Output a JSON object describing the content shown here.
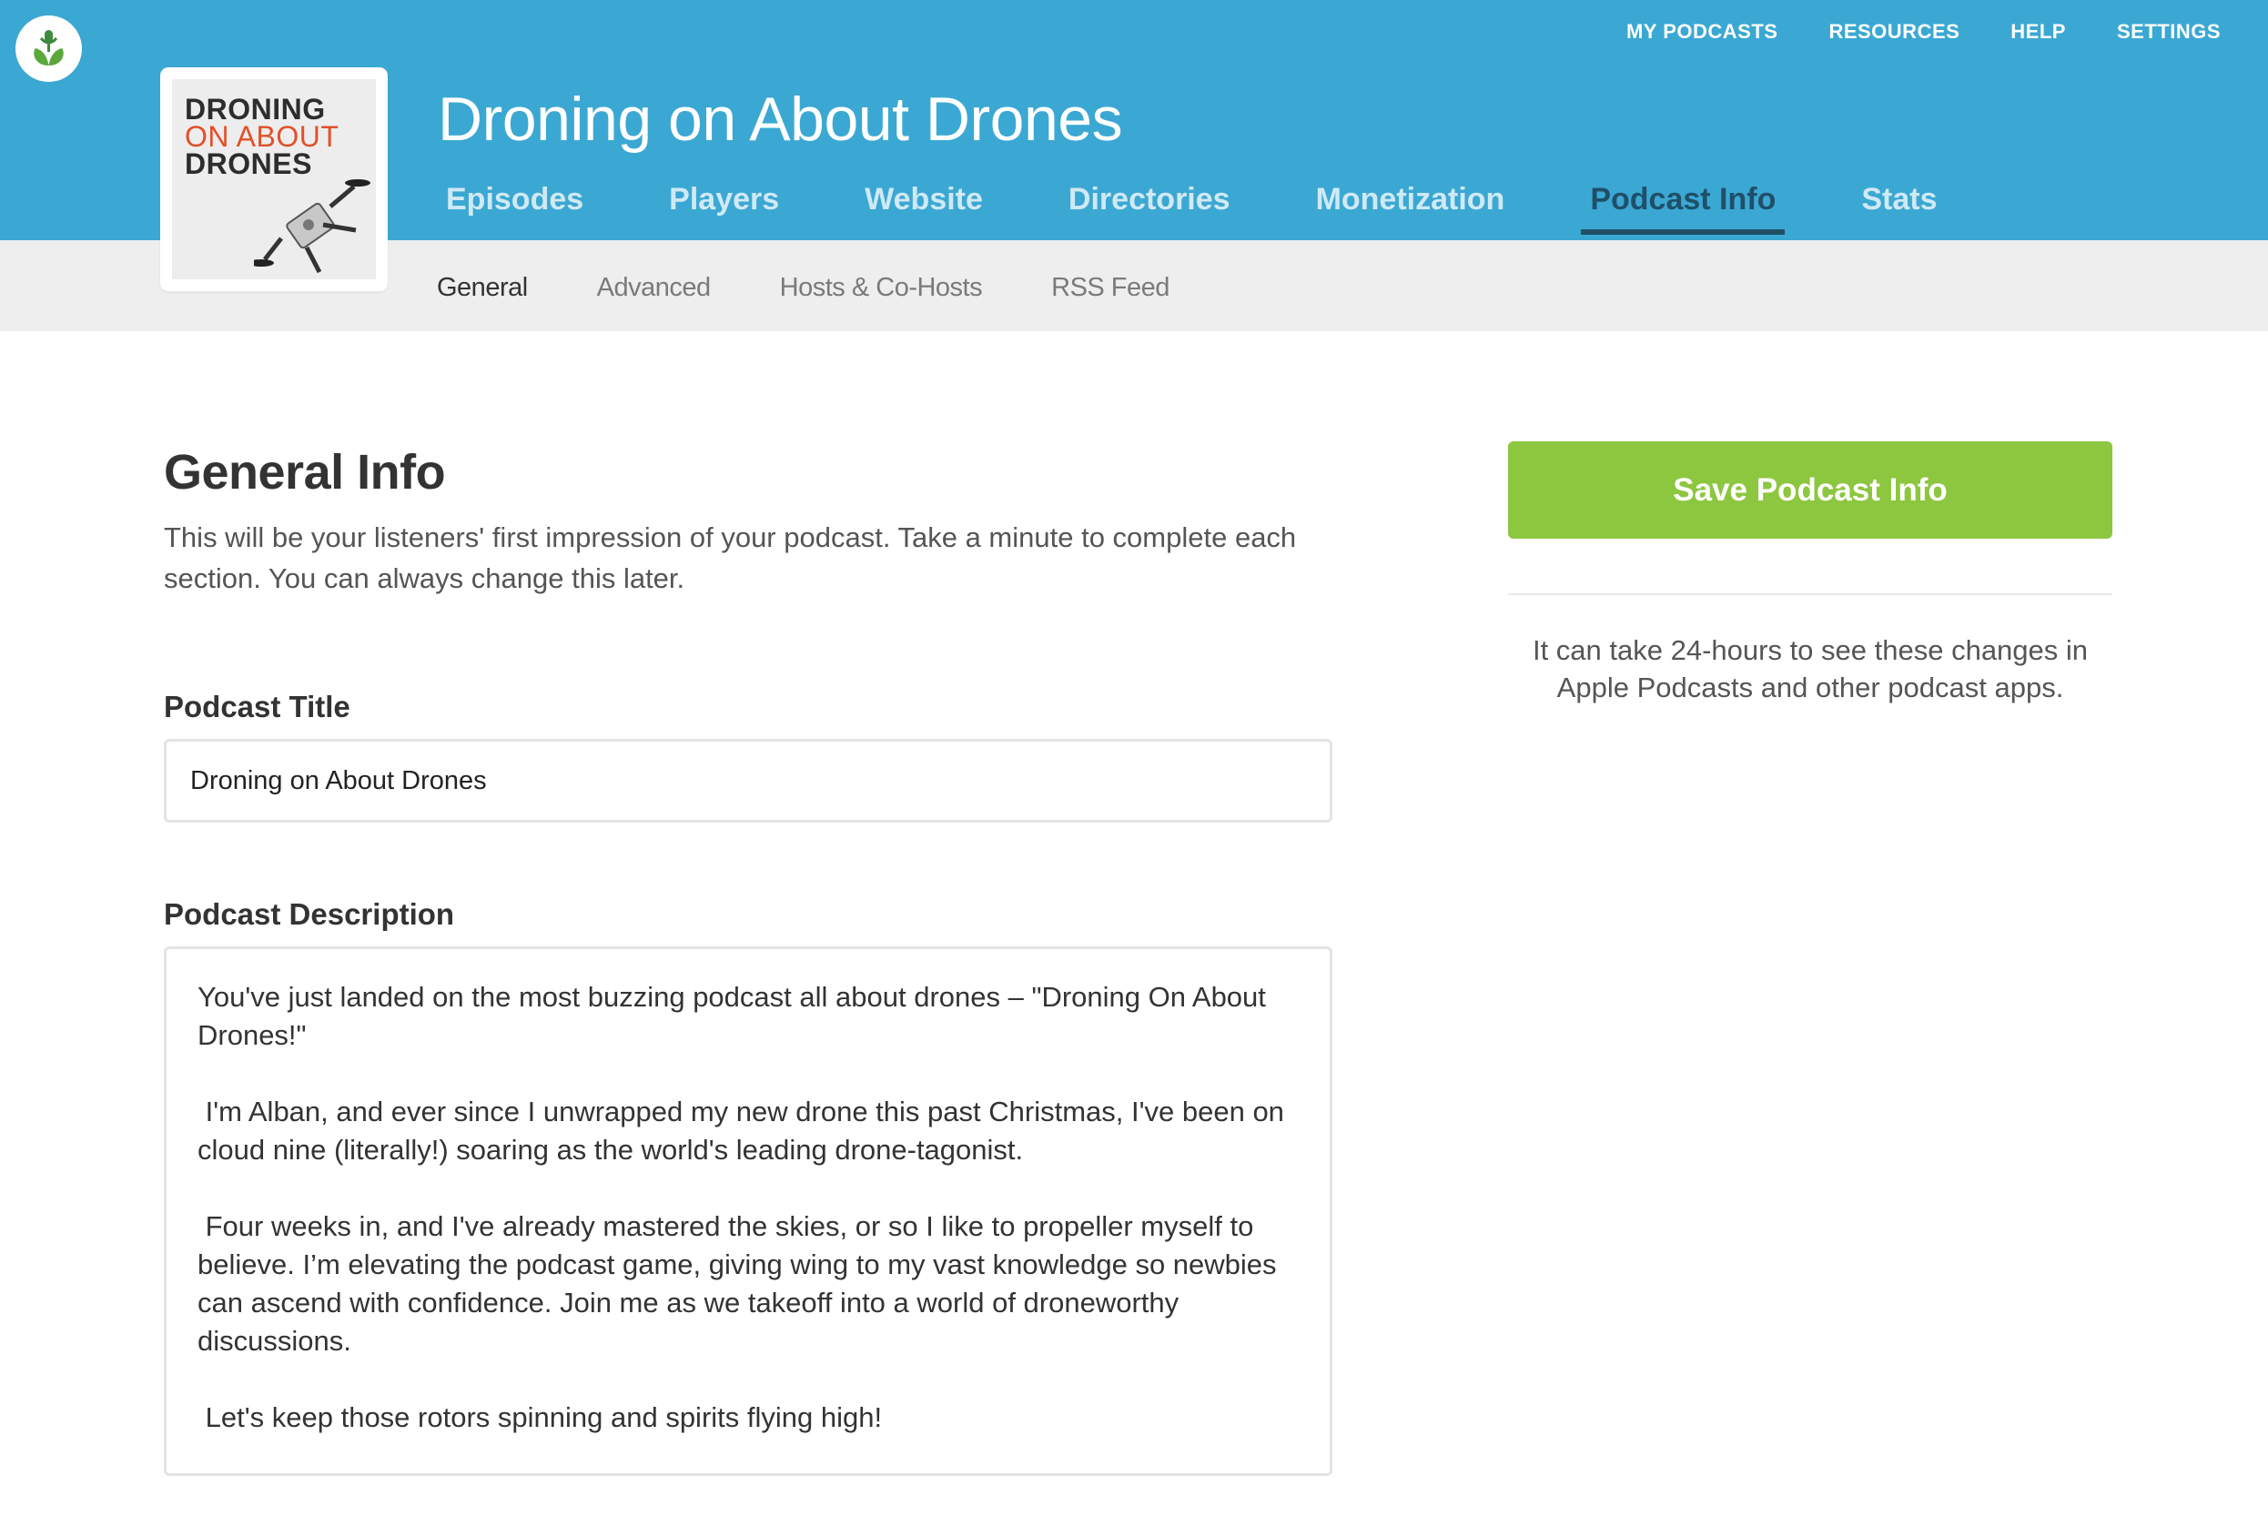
{
  "top_nav": {
    "items": [
      "MY PODCASTS",
      "RESOURCES",
      "HELP",
      "SETTINGS"
    ]
  },
  "artwork": {
    "line1": "DRONING",
    "line2": "ON ABOUT",
    "line3": "DRONES"
  },
  "podcast": {
    "title": "Droning on About Drones"
  },
  "main_nav": {
    "items": [
      "Episodes",
      "Players",
      "Website",
      "Directories",
      "Monetization",
      "Podcast Info",
      "Stats"
    ],
    "active": "Podcast Info"
  },
  "sub_nav": {
    "items": [
      "General",
      "Advanced",
      "Hosts & Co-Hosts",
      "RSS Feed"
    ],
    "active": "General"
  },
  "form": {
    "heading": "General Info",
    "intro": "This will be your listeners' first impression of your podcast. Take a minute to complete each section. You can always change this later.",
    "title_label": "Podcast Title",
    "title_value": "Droning on About Drones",
    "description_label": "Podcast Description",
    "description_paragraphs": [
      "You've just landed on the most buzzing podcast all about drones – \"Droning On About Drones!\"",
      " I'm Alban, and ever since I unwrapped my new drone this past Christmas, I've been on cloud nine (literally!) soaring as the world's leading drone-tagonist.",
      " Four weeks in, and I've already mastered the skies, or so I like to propeller myself to believe. I’m elevating the podcast game, giving wing to my vast knowledge so newbies can ascend with confidence. Join me as we takeoff into a world of droneworthy discussions.",
      " Let's keep those rotors spinning and spirits flying high!"
    ]
  },
  "sidebar": {
    "save_label": "Save Podcast Info",
    "note": "It can take 24-hours to see these changes in Apple Podcasts and other podcast apps."
  },
  "colors": {
    "header_blue": "#3ba8d3",
    "active_tab": "#1f4f69",
    "save_green": "#8dc63f",
    "artwork_orange": "#e2502a"
  }
}
